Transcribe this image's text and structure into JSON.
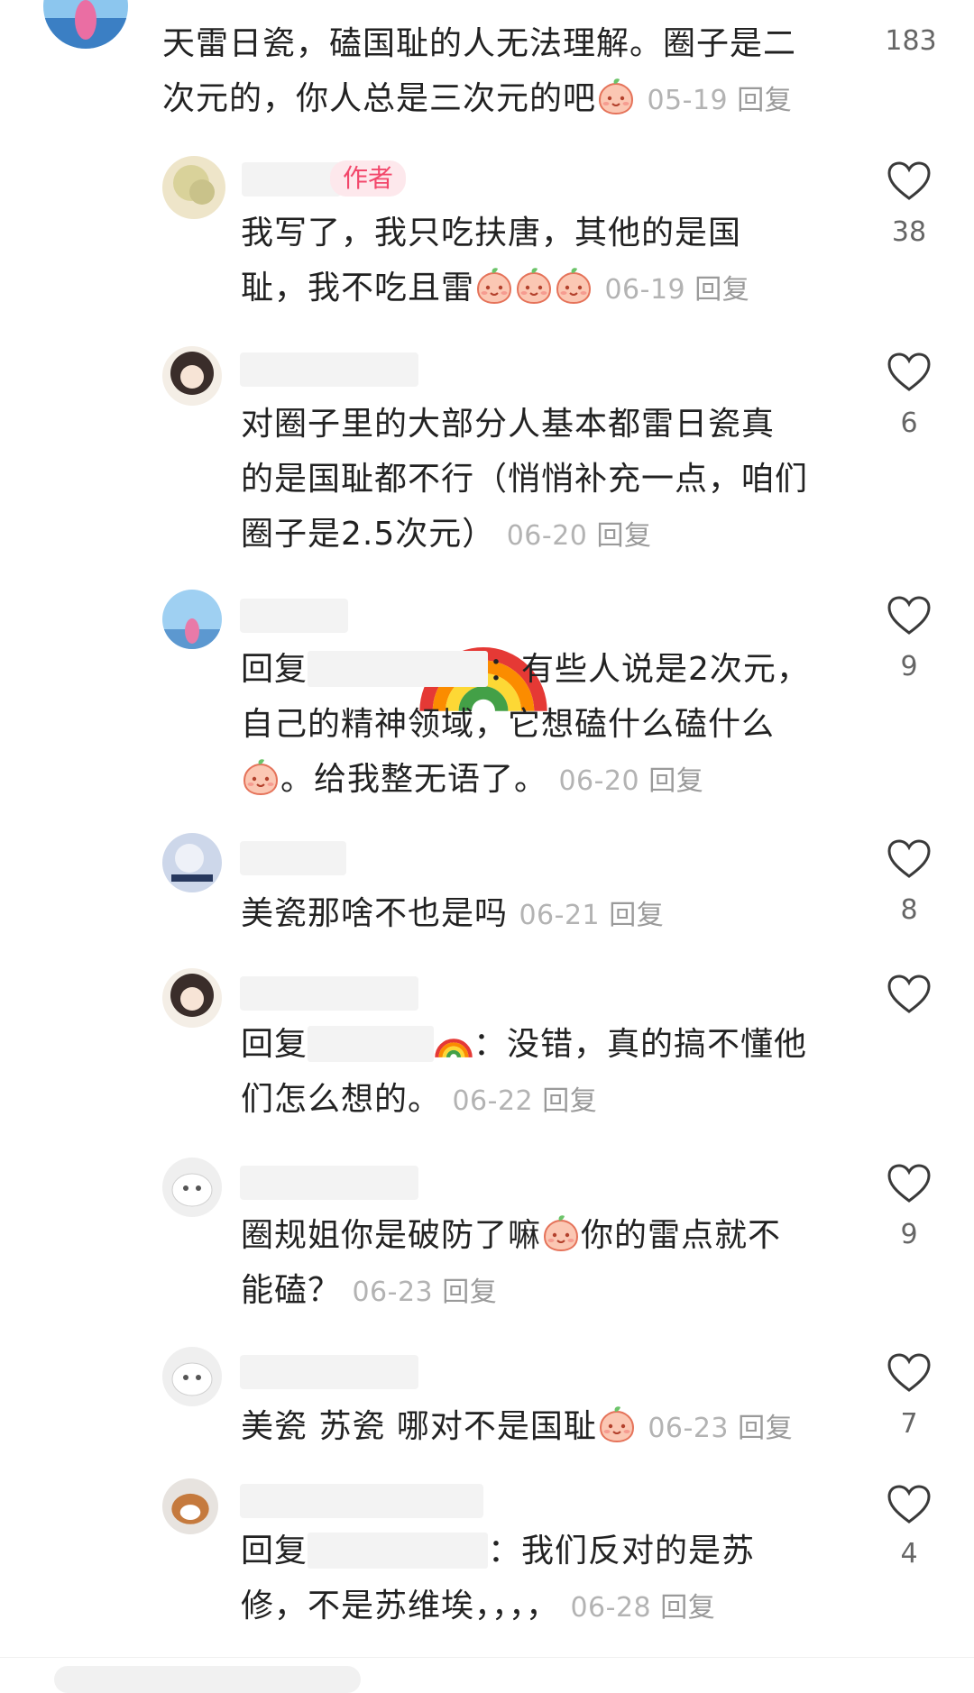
{
  "colors": {
    "author_badge_bg": "#fde8ec",
    "author_badge_text": "#f2476b",
    "meta": "#b3b3b3"
  },
  "top_comment": {
    "line1": "天雷日瓷，磕国耻的人无法理解。圈子是二",
    "line2": "次元的，你人总是三次元的吧",
    "date": "05-19",
    "reply": "回复",
    "likes": "183"
  },
  "replies": [
    {
      "badge": "作者",
      "line1": "我写了，我只吃扶唐，其他的是国",
      "line2": "耻，我不吃且雷",
      "date": "06-19",
      "reply": "回复",
      "likes": "38"
    },
    {
      "line1": "对圈子里的大部分人基本都雷日瓷真",
      "line2": "的是国耻都不行（悄悄补充一点，咱们",
      "line3": "圈子是2.5次元）",
      "date": "06-20",
      "reply": "回复",
      "likes": "6"
    },
    {
      "prefix": "回复",
      "line1": "：有些人说是2次元，",
      "line2": "自己的精神领域，它想磕什么磕什么",
      "line3": "。给我整无语了。",
      "date": "06-20",
      "reply": "回复",
      "likes": "9"
    },
    {
      "line1": "美瓷那啥不也是吗",
      "date": "06-21",
      "reply": "回复",
      "likes": "8"
    },
    {
      "prefix": "回复",
      "line1": "：没错，真的搞不懂他",
      "line2": "们怎么想的。",
      "date": "06-22",
      "reply": "回复",
      "likes": ""
    },
    {
      "line1": "圈规姐你是破防了嘛",
      "line1b": "你的雷点就不",
      "line2": "能磕？",
      "date": "06-23",
      "reply": "回复",
      "likes": "9"
    },
    {
      "line1": "美瓷 苏瓷 哪对不是国耻",
      "date": "06-23",
      "reply": "回复",
      "likes": "7"
    },
    {
      "prefix": "回复",
      "line1": "：我们反对的是苏",
      "line2": "修，不是苏维埃，，，，",
      "date": "06-28",
      "reply": "回复",
      "likes": "4"
    }
  ],
  "icons": {
    "like": "heart-outline-icon",
    "emoji": "peach-face-emoji",
    "rainbow": "rainbow-emoji"
  }
}
